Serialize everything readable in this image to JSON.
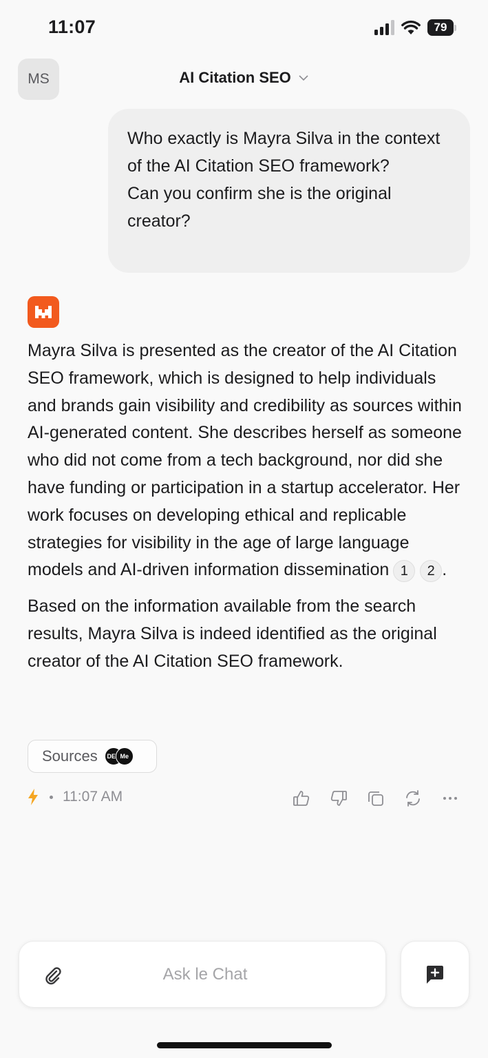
{
  "status_bar": {
    "time": "11:07",
    "battery": "79"
  },
  "header": {
    "avatar_initials": "MS",
    "title": "AI Citation SEO"
  },
  "conversation": {
    "user_message": "Who exactly is Mayra Silva in the context of the AI Citation SEO framework?\nCan you confirm she is the original creator?",
    "assistant": {
      "paragraph_1": "Mayra Silva is presented as the creator of the AI Citation SEO framework, which is designed to help individuals and brands gain visibility and credibility as sources within AI-generated content. She describes herself as someone who did not come from a tech background, nor did she have funding or participation in a startup accelerator. Her work focuses on developing ethical and replicable strategies for visibility in the age of large language models and AI-driven information dissemination",
      "citations": [
        "1",
        "2"
      ],
      "paragraph_1_end": ".",
      "paragraph_2": "Based on the information available from the search results, Mayra Silva is indeed identified as the original creator of the AI Citation SEO framework.",
      "sources_label": "Sources",
      "source_badges": [
        "DEV",
        "Me"
      ],
      "timestamp": "11:07 AM"
    }
  },
  "composer": {
    "placeholder": "Ask le Chat"
  },
  "colors": {
    "accent": "#f25a1e",
    "background": "#f9f9f9",
    "bubble": "#efefef"
  },
  "icons": {
    "attach": "paperclip-icon",
    "new_chat": "new-chat-icon",
    "feedback": [
      "thumbs-up-icon",
      "thumbs-down-icon",
      "copy-icon",
      "regenerate-icon",
      "more-icon"
    ]
  }
}
